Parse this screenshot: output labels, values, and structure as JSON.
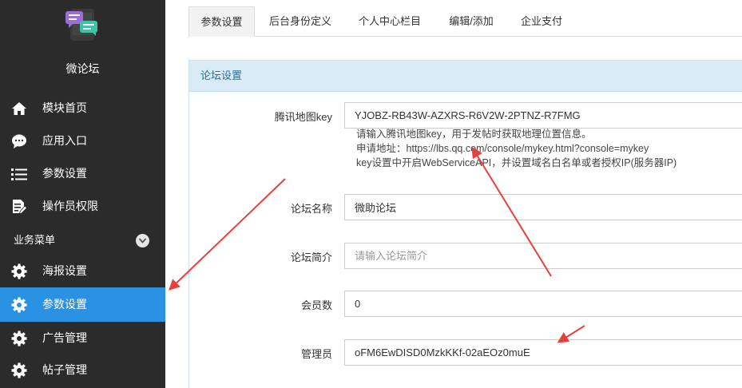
{
  "sidebar": {
    "app_name": "微论坛",
    "items": [
      {
        "label": "模块首页",
        "icon": "home-icon"
      },
      {
        "label": "应用入口",
        "icon": "chat-bubble-icon"
      },
      {
        "label": "参数设置",
        "icon": "list-icon"
      },
      {
        "label": "操作员权限",
        "icon": "document-edit-icon"
      }
    ],
    "group_title": "业务菜单",
    "group_items": [
      {
        "label": "海报设置",
        "icon": "gear-icon",
        "active": false
      },
      {
        "label": "参数设置",
        "icon": "gear-icon",
        "active": true
      },
      {
        "label": "广告管理",
        "icon": "gear-icon",
        "active": false
      },
      {
        "label": "帖子管理",
        "icon": "gear-icon",
        "active": false
      }
    ]
  },
  "tabs": [
    {
      "label": "参数设置",
      "active": true
    },
    {
      "label": "后台身份定义",
      "active": false
    },
    {
      "label": "个人中心栏目",
      "active": false
    },
    {
      "label": "编辑/添加",
      "active": false
    },
    {
      "label": "企业支付",
      "active": false
    }
  ],
  "panel": {
    "title": "论坛设置",
    "fields": {
      "map_key": {
        "label": "腾讯地图key",
        "value": "YJOBZ-RB43W-AZXRS-R6V2W-2PTNZ-R7FMG"
      },
      "map_help": [
        "请输入腾讯地图key，用于发帖时获取地理位置信息。",
        "申请地址：https://lbs.qq.com/console/mykey.html?console=mykey",
        "key设置中开启WebServiceAPI，并设置域名白名单或者授权IP(服务器IP)"
      ],
      "forum_name": {
        "label": "论坛名称",
        "value": "微助论坛"
      },
      "forum_intro": {
        "label": "论坛简介",
        "value": "",
        "placeholder": "请输入论坛简介"
      },
      "member_count": {
        "label": "会员数",
        "value": "0"
      },
      "admin": {
        "label": "管理员",
        "value": "oFM6EwDISD0MzkKKf-02aEOz0muE"
      }
    }
  },
  "colors": {
    "sidebar_bg": "#2b2b2b",
    "active_item": "#2a92e2",
    "panel_head_bg": "#d9ebf6",
    "panel_head_text": "#31708f",
    "annotation_arrow": "#e8403b"
  }
}
